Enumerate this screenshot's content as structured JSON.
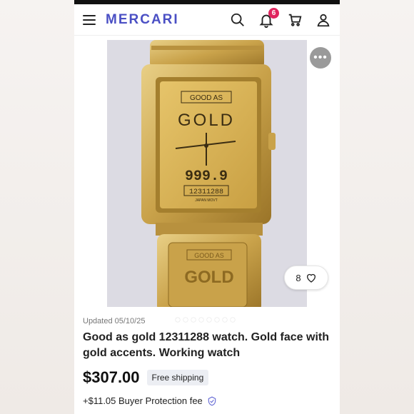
{
  "nav": {
    "logo": "MERCARI",
    "notification_count": "6",
    "icons": [
      "menu-icon",
      "search-icon",
      "bell-icon",
      "cart-icon",
      "user-icon"
    ]
  },
  "gallery": {
    "photo_alt": "Gold watch photo",
    "like_count": "8",
    "dot_count": 8,
    "active_dot": 0
  },
  "listing": {
    "updated": "Updated 05/10/25",
    "title": "Good as gold 12311288 watch. Gold face with gold accents. Working watch",
    "price": "$307.00",
    "shipping_badge": "Free shipping",
    "protection_fee": "+$11.05 Buyer Protection fee"
  },
  "watch_face": {
    "brand_box": "GOOD AS",
    "brand": "GOLD",
    "purity": "999.9",
    "serial": "12311288",
    "origin": "JAPAN    MOVT"
  },
  "colors": {
    "brand_accent": "#4a4fc4",
    "badge": "#e0245e",
    "gold": "#d9b75a"
  }
}
